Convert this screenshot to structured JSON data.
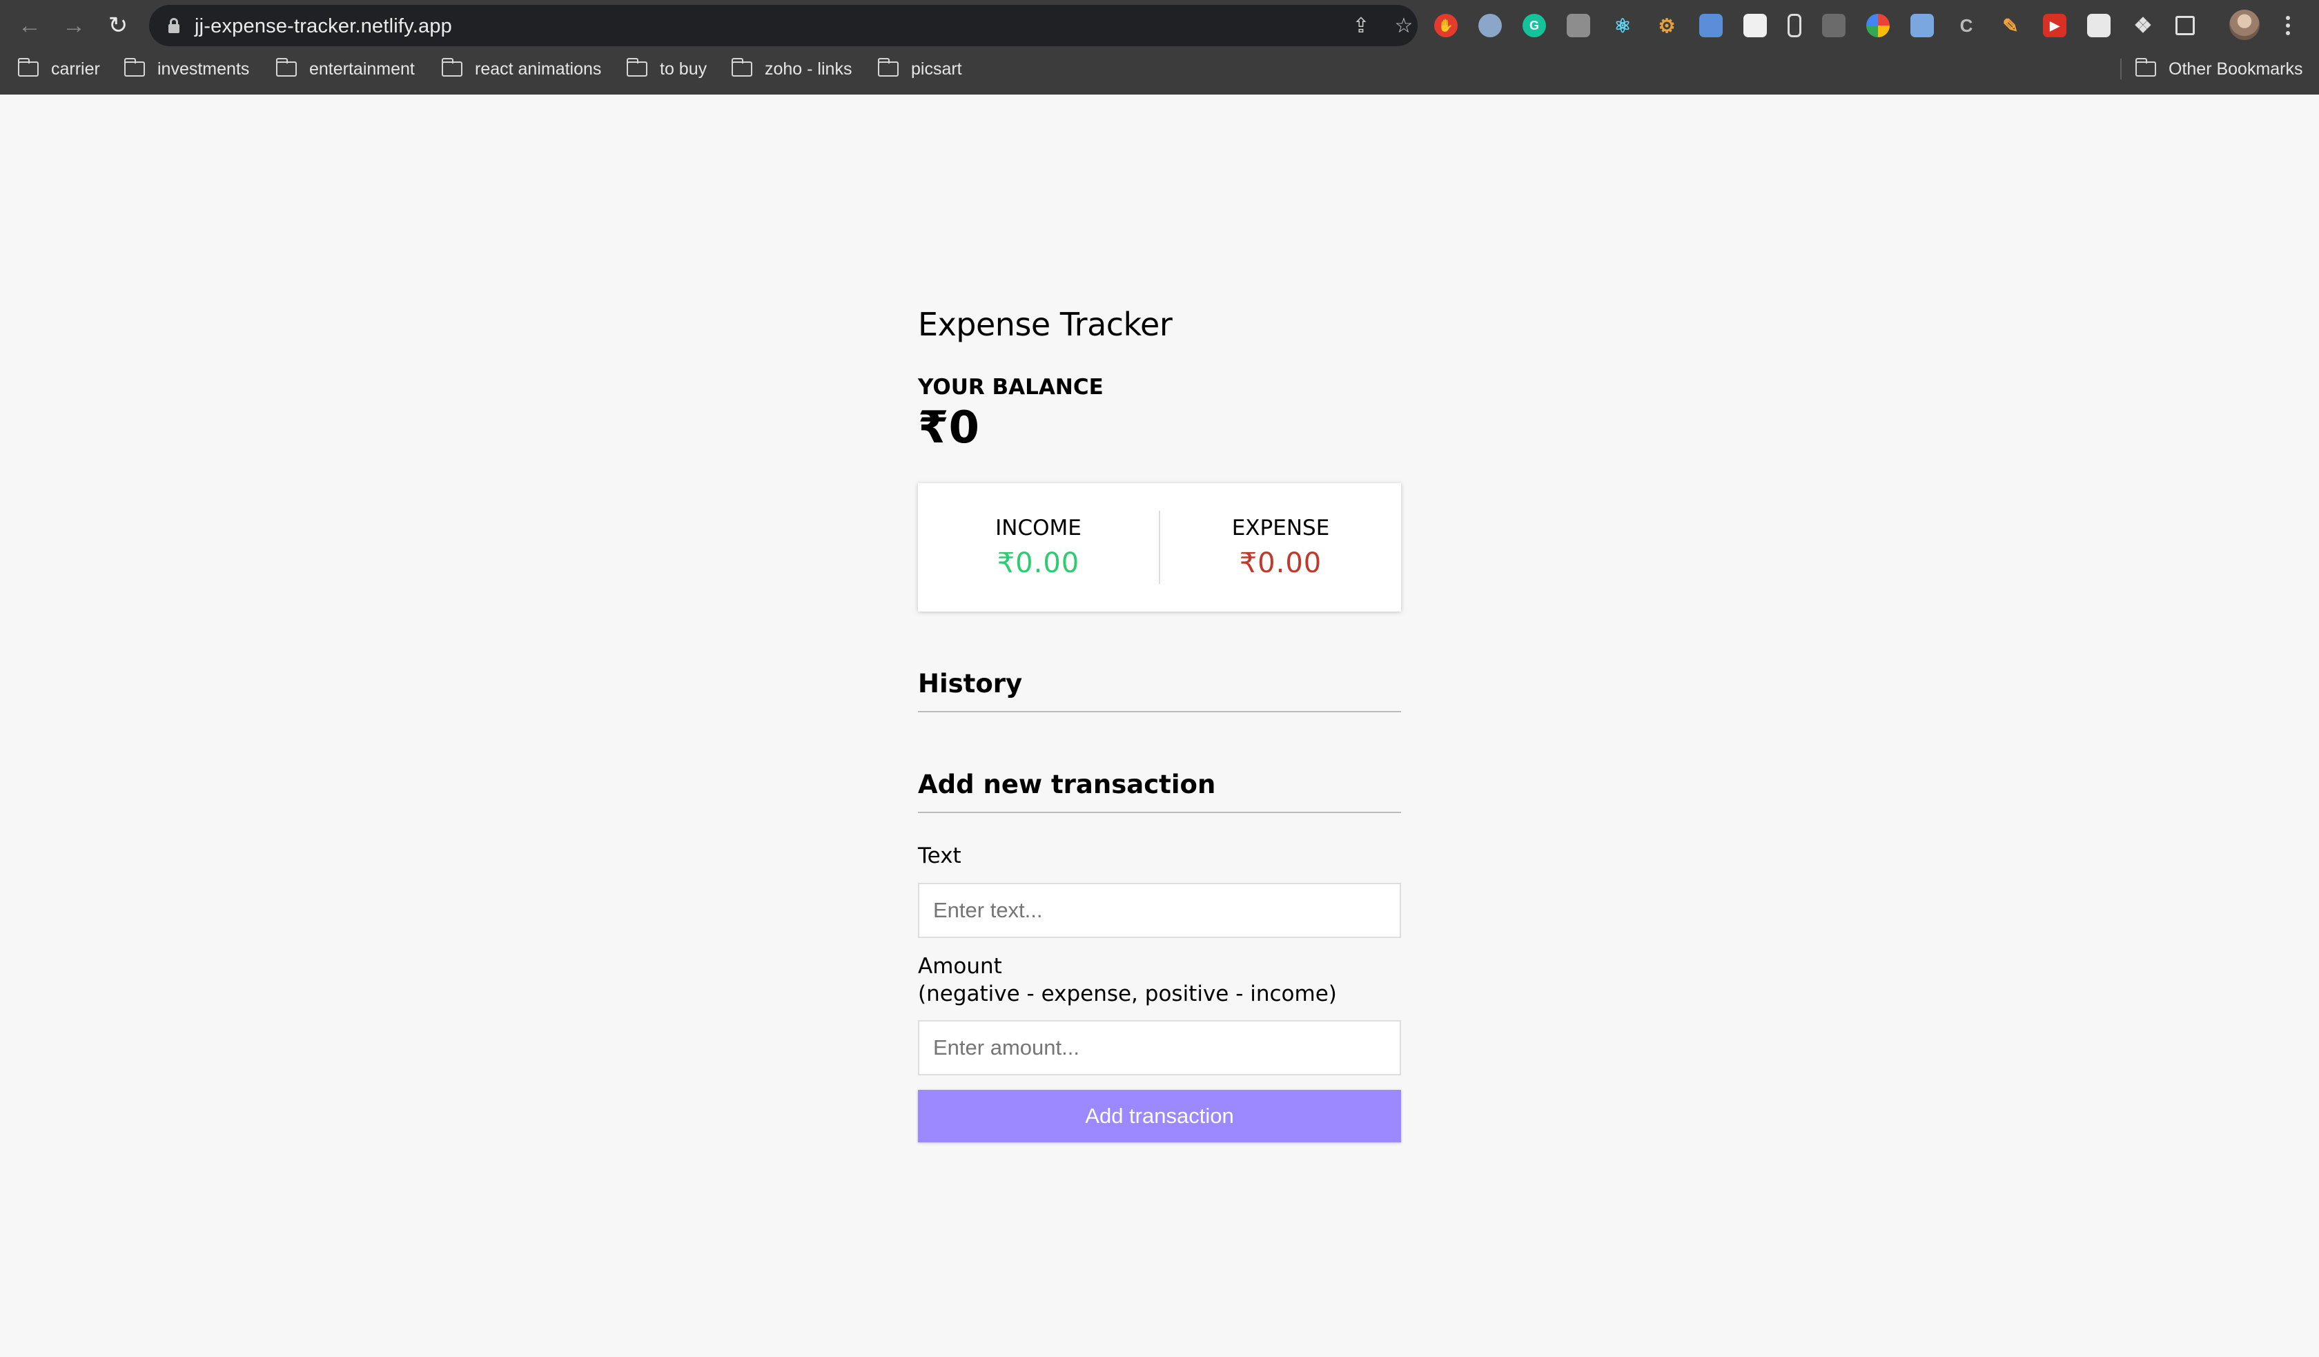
{
  "browser": {
    "url": "jj-expense-tracker.netlify.app",
    "bookmarks": [
      "carrier",
      "investments",
      "entertainment",
      "react animations",
      "to buy",
      "zoho - links",
      "picsart"
    ],
    "other_bookmarks": "Other Bookmarks"
  },
  "app": {
    "title": "Expense Tracker",
    "balance_label": "YOUR BALANCE",
    "balance_value": "₹0",
    "income_label": "INCOME",
    "income_value": "₹0.00",
    "expense_label": "EXPENSE",
    "expense_value": "₹0.00",
    "history_title": "History",
    "add_title": "Add new transaction",
    "text_label": "Text",
    "text_placeholder": "Enter text...",
    "amount_label": "Amount",
    "amount_hint": "(negative - expense, positive - income)",
    "amount_placeholder": "Enter amount...",
    "submit_label": "Add transaction"
  },
  "colors": {
    "income": "#2ecc71",
    "expense": "#c0392b",
    "button": "#9c88ff"
  }
}
